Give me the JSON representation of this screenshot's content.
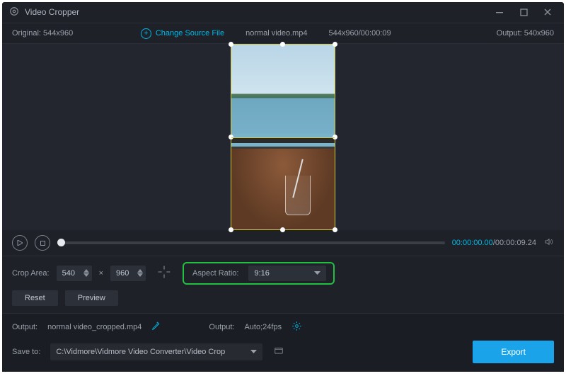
{
  "title": "Video Cropper",
  "top": {
    "original_label": "Original:",
    "original_value": "544x960",
    "change_source": "Change Source File",
    "filename": "normal video.mp4",
    "src_info": "544x960/00:00:09",
    "output_label": "Output:",
    "output_value": "540x960"
  },
  "transport": {
    "current": "00:00:00.00",
    "sep": "/",
    "total": "00:00:09.24"
  },
  "crop": {
    "label": "Crop Area:",
    "width": "540",
    "times": "×",
    "height": "960",
    "aspect_label": "Aspect Ratio:",
    "aspect_value": "9:16",
    "reset": "Reset",
    "preview": "Preview"
  },
  "bottom": {
    "output_label": "Output:",
    "output_file": "normal video_cropped.mp4",
    "fmt_label": "Output:",
    "fmt_value": "Auto;24fps",
    "save_label": "Save to:",
    "save_path": "C:\\Vidmore\\Vidmore Video Converter\\Video Crop",
    "export": "Export"
  }
}
